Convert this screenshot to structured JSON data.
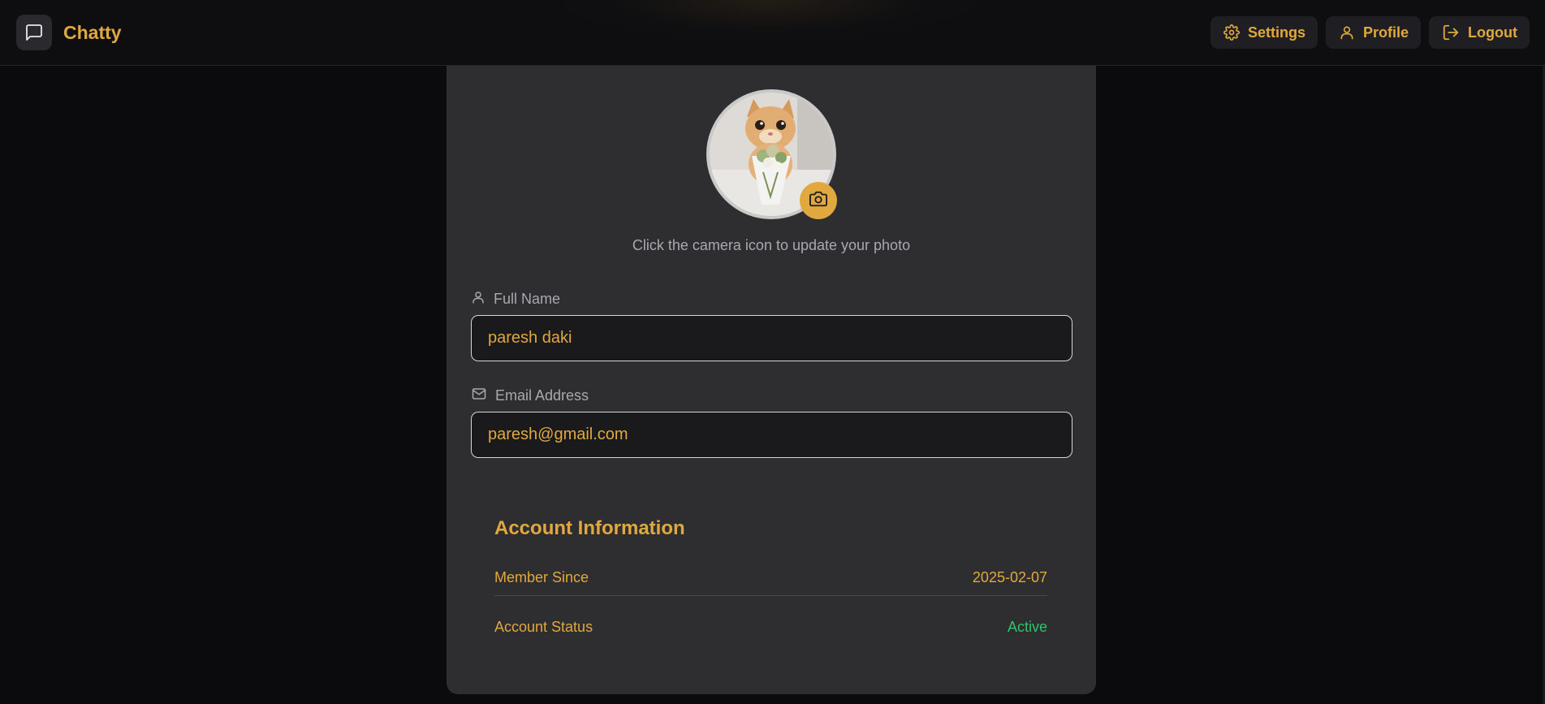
{
  "app": {
    "name": "Chatty"
  },
  "nav": {
    "settings_label": "Settings",
    "profile_label": "Profile",
    "logout_label": "Logout"
  },
  "profile": {
    "photo_hint": "Click the camera icon to update your photo",
    "full_name": {
      "label": "Full Name",
      "value": "paresh daki"
    },
    "email": {
      "label": "Email Address",
      "value": "paresh@gmail.com"
    }
  },
  "account": {
    "title": "Account Information",
    "member_since_label": "Member Since",
    "member_since_value": "2025-02-07",
    "status_label": "Account Status",
    "status_value": "Active"
  },
  "icons": {
    "brand": "message-square-icon",
    "settings": "gear-icon",
    "profile": "user-icon",
    "logout": "logout-icon",
    "camera": "camera-icon",
    "full_name": "user-icon",
    "email": "mail-icon"
  },
  "colors": {
    "accent": "#e0a83e",
    "status_active": "#2fc46a",
    "card_bg": "#2e2e31",
    "page_bg": "#0b0b0d"
  }
}
